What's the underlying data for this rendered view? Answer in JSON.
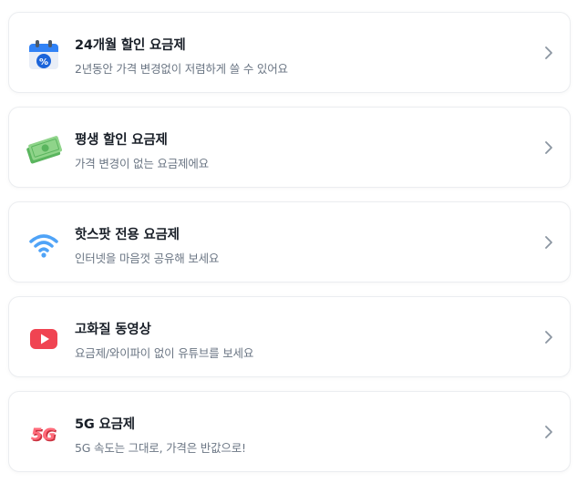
{
  "plans": [
    {
      "icon": "calendar-discount-icon",
      "title": "24개월 할인 요금제",
      "description": "2년동안 가격 변경없이 저렴하게 쓸 수 있어요"
    },
    {
      "icon": "money-bills-icon",
      "title": "평생 할인 요금제",
      "description": "가격 변경이 없는 요금제에요"
    },
    {
      "icon": "wifi-hotspot-icon",
      "title": "핫스팟 전용 요금제",
      "description": "인터넷을 마음껏 공유해 보세요"
    },
    {
      "icon": "video-play-icon",
      "title": "고화질 동영상",
      "description": "요금제/와이파이 없이 유튜브를 보세요"
    },
    {
      "icon": "5g-badge-icon",
      "icon_text": "5G",
      "title": "5G 요금제",
      "description": "5G 속도는 그대로, 가격은 반값으로!"
    }
  ],
  "colors": {
    "title": "#191f28",
    "description": "#6b7684",
    "chevron": "#8b95a1",
    "card_border": "#ebedf0"
  }
}
